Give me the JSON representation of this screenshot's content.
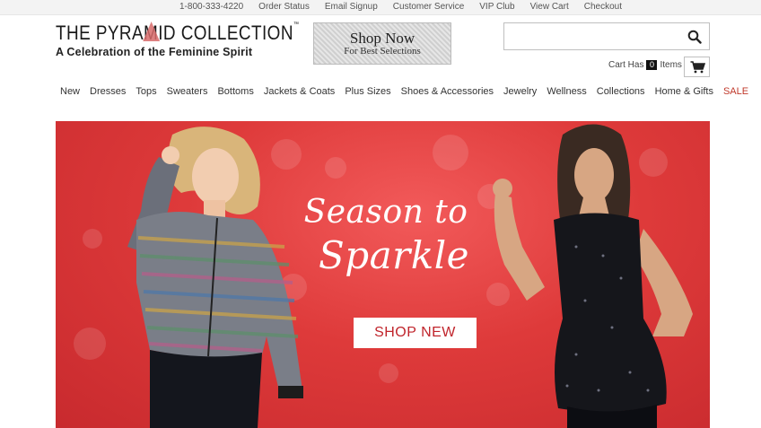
{
  "topbar": {
    "links": [
      "1-800-333-4220",
      "Order Status",
      "Email Signup",
      "Customer Service",
      "VIP Club",
      "View Cart",
      "Checkout"
    ]
  },
  "logo": {
    "title": "THE PYRAMID COLLECTION",
    "subtitle": "A Celebration of the Feminine Spirit"
  },
  "promo": {
    "main": "Shop Now",
    "sub": "For Best Selections"
  },
  "search": {
    "placeholder": "",
    "value": "",
    "icon": "search-icon"
  },
  "cart": {
    "label_before": "Cart Has",
    "count": "0",
    "label_after": "Items",
    "icon": "cart-icon"
  },
  "nav": {
    "items": [
      "New",
      "Dresses",
      "Tops",
      "Sweaters",
      "Bottoms",
      "Jackets & Coats",
      "Plus Sizes",
      "Shoes & Accessories",
      "Jewelry",
      "Wellness",
      "Collections",
      "Home & Gifts"
    ],
    "sale": "SALE"
  },
  "hero": {
    "title_line1": "Season to",
    "title_line2": "Sparkle",
    "cta": "SHOP NEW"
  },
  "colors": {
    "accent": "#c0242b",
    "hero_bg": "#de3a3a",
    "sale": "#c0392b"
  }
}
